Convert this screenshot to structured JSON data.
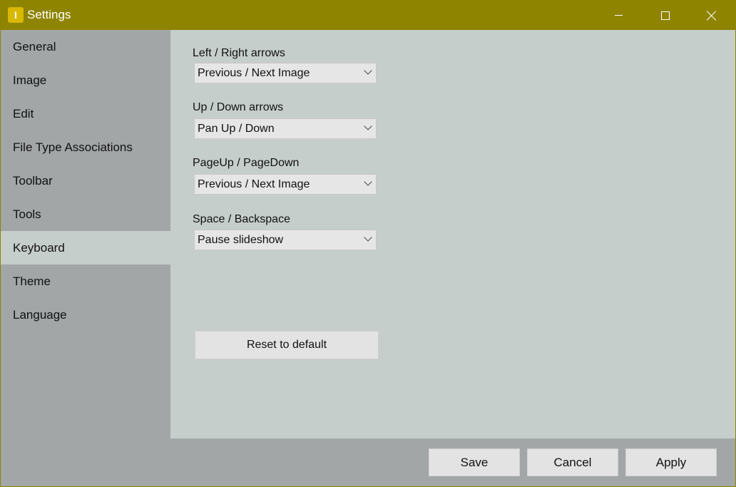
{
  "window": {
    "title": "Settings",
    "icon": "app-logo-icon",
    "titlebar_color": "#8e8400"
  },
  "sidebar": {
    "items": [
      {
        "label": "General"
      },
      {
        "label": "Image"
      },
      {
        "label": "Edit"
      },
      {
        "label": "File Type Associations"
      },
      {
        "label": "Toolbar"
      },
      {
        "label": "Tools"
      },
      {
        "label": "Keyboard",
        "active": true
      },
      {
        "label": "Theme"
      },
      {
        "label": "Language"
      }
    ]
  },
  "keyboard": {
    "fields": [
      {
        "label": "Left / Right arrows",
        "value": "Previous / Next Image"
      },
      {
        "label": "Up / Down arrows",
        "value": "Pan Up / Down"
      },
      {
        "label": "PageUp / PageDown",
        "value": "Previous / Next Image"
      },
      {
        "label": "Space / Backspace",
        "value": "Pause slideshow"
      }
    ],
    "reset_label": "Reset to default"
  },
  "footer": {
    "save_label": "Save",
    "cancel_label": "Cancel",
    "apply_label": "Apply"
  }
}
